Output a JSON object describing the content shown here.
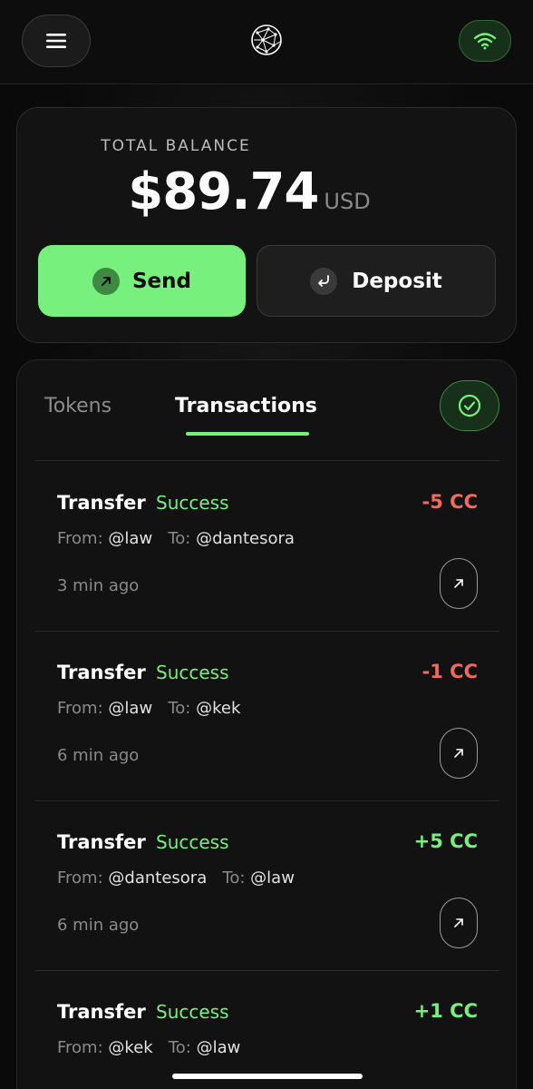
{
  "header": {
    "menu_icon": "hamburger-menu-icon",
    "logo_icon": "globe-network-icon",
    "status_icon": "wifi-icon"
  },
  "balance": {
    "label": "TOTAL BALANCE",
    "amount": "$89.74",
    "currency": "USD",
    "send_label": "Send",
    "deposit_label": "Deposit"
  },
  "tabs": {
    "tokens": "Tokens",
    "transactions": "Transactions",
    "active": "Transactions"
  },
  "transactions": [
    {
      "type": "Transfer",
      "status": "Success",
      "amount": "-5 CC",
      "from_label": "From:",
      "from": "@law",
      "to_label": "To:",
      "to": "@dantesora",
      "time": "3 min ago"
    },
    {
      "type": "Transfer",
      "status": "Success",
      "amount": "-1 CC",
      "from_label": "From:",
      "from": "@law",
      "to_label": "To:",
      "to": "@kek",
      "time": "6 min ago"
    },
    {
      "type": "Transfer",
      "status": "Success",
      "amount": "+5 CC",
      "from_label": "From:",
      "from": "@dantesora",
      "to_label": "To:",
      "to": "@law",
      "time": "6 min ago"
    },
    {
      "type": "Transfer",
      "status": "Success",
      "amount": "+1 CC",
      "from_label": "From:",
      "from": "@kek",
      "to_label": "To:",
      "to": "@law",
      "time": ""
    }
  ],
  "colors": {
    "accent": "#77f07d",
    "negative": "#f06a5e",
    "positive": "#77f07d",
    "background": "#0a0a0a"
  }
}
